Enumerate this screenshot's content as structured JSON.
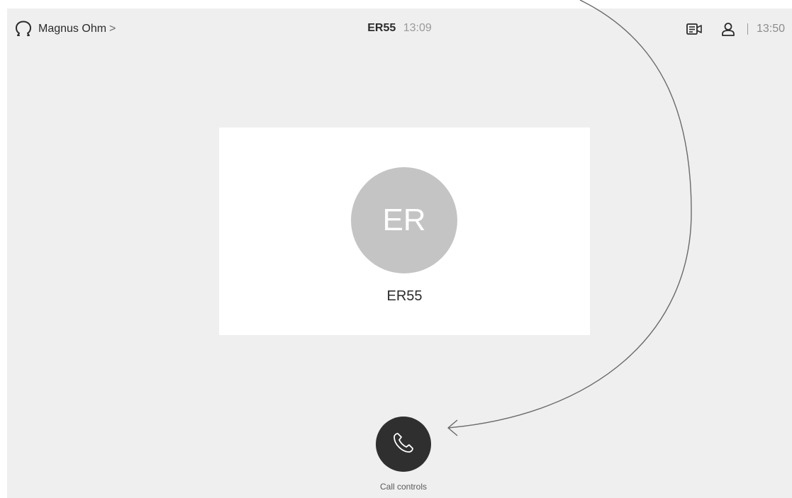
{
  "header": {
    "user_name": "Magnus Ohm",
    "user_chevron": ">",
    "call_name": "ER55",
    "call_duration": "13:09",
    "clock": "13:50"
  },
  "participant": {
    "initials": "ER",
    "name": "ER55"
  },
  "controls": {
    "call_controls_label": "Call controls"
  },
  "icons": {
    "user": "omega-headset-icon",
    "layout": "layout-icon",
    "self_view": "person-icon",
    "call": "phone-handset-icon",
    "annotation": "curved-arrow-annotation"
  },
  "colors": {
    "background": "#efefef",
    "card": "#ffffff",
    "avatar": "#c4c4c4",
    "call_button": "#2f2f2f"
  }
}
